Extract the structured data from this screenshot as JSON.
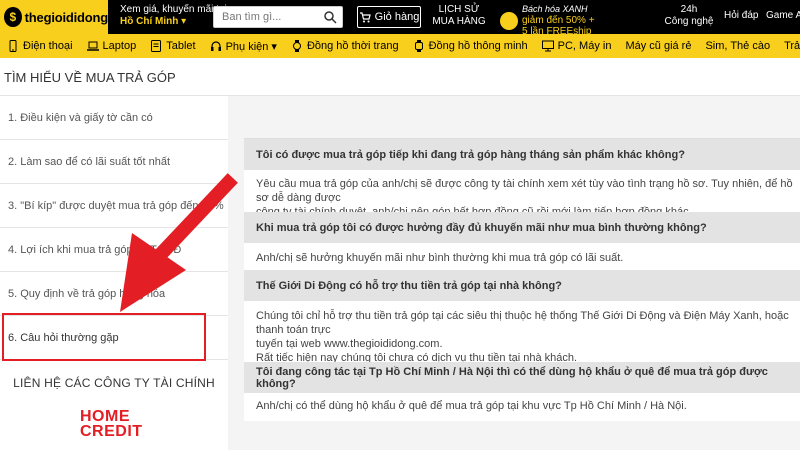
{
  "header": {
    "logo_text": "thegioididong",
    "logo_mark": "$",
    "promo_text": "Xem giá, khuyến mãi tại",
    "location": "Hồ Chí Minh ▾",
    "search_placeholder": "Ban tìm gì...",
    "cart_label": "Giỏ hàng",
    "history_line1": "LỊCH SỬ",
    "history_line2": "MUA HÀNG",
    "bhx_name": "Bách hóa XANH",
    "bhx_offer1": "giảm đến 50% +",
    "bhx_offer2": "5 lần FREEship",
    "tech_line1": "24h",
    "tech_line2": "Công nghệ",
    "hoidap": "Hỏi đáp",
    "gameapp": "Game App"
  },
  "nav": {
    "items": [
      {
        "label": "Điện thoại",
        "icon": "phone-icon"
      },
      {
        "label": "Laptop",
        "icon": "laptop-icon"
      },
      {
        "label": "Tablet",
        "icon": "tablet-icon"
      },
      {
        "label": "Phụ kiện ▾",
        "icon": "headphone-icon"
      },
      {
        "label": "Đồng hồ thời trang",
        "icon": "watch-icon"
      },
      {
        "label": "Đồng hồ thông minh",
        "icon": "smartwatch-icon"
      },
      {
        "label": "PC, Máy in",
        "icon": "pc-icon"
      },
      {
        "label": "Máy cũ giá rẻ",
        "icon": ""
      },
      {
        "label": "Sim, Thẻ cào",
        "icon": ""
      },
      {
        "label": "Trả góp, điện nư",
        "icon": ""
      }
    ]
  },
  "page": {
    "title": "TÌM HIỂU VỀ MUA TRẢ GÓP"
  },
  "sidebar": {
    "items": [
      {
        "label": "1. Điều kiện và giấy tờ cần có"
      },
      {
        "label": "2. Làm sao để có lãi suất tốt nhất"
      },
      {
        "label": "3. \"Bí kíp\" được duyệt mua trả góp đến 90%"
      },
      {
        "label": "4. Lợi ích khi mua trả góp tại TGDĐ"
      },
      {
        "label": "5. Quy định về trả góp hàng hóa"
      },
      {
        "label": "6. Câu hỏi thường gặp"
      }
    ],
    "contact_title": "LIÊN HỆ CÁC CÔNG TY TÀI CHÍNH",
    "hc_line1": "HOME",
    "hc_line2": "CREDIT"
  },
  "faq": [
    {
      "q": "Tôi có được mua trả góp tiếp khi đang trả góp hàng tháng sản phẩm khác không?",
      "a": [
        "Yêu cầu mua trả góp của anh/chị sẽ được công ty tài chính xem xét tùy vào tình trạng hồ sơ. Tuy nhiên, để hồ sơ dễ dàng được",
        "công ty tài chính duyệt, anh/chị nên góp hết hợp đồng cũ rồi mới làm tiếp hợp đồng khác."
      ]
    },
    {
      "q": "Khi mua trả góp tôi có được hưởng đầy đủ khuyến mãi như mua bình thường không?",
      "a": [
        "Anh/chị sẽ hưởng khuyến mãi như bình thường khi mua trả góp có lãi suất."
      ]
    },
    {
      "q": "Thế Giới Di Động có hỗ trợ thu tiền trả góp tại nhà không?",
      "a": [
        "Chúng tôi chỉ hỗ trợ thu tiền trả góp tại các siêu thị thuộc hệ thống Thế Giới Di Động và Điện Máy Xanh, hoặc thanh toán trực",
        "tuyến tại web www.thegioididong.com.",
        "Rất tiếc hiện nay chúng tôi chưa có dịch vụ thu tiền tại nhà khách."
      ]
    },
    {
      "q": "Tôi đang công tác tại Tp Hồ Chí Minh / Hà Nội thì có thể dùng hộ khẩu ở quê để mua trả góp được không?",
      "a": [
        "Anh/chị có thể dùng hộ khẩu ở quê để mua trả góp tại khu vực Tp Hồ Chí Minh / Hà Nội."
      ]
    }
  ],
  "colors": {
    "brand_yellow": "#f8cf1c",
    "header_black": "#000000",
    "highlight_red": "#e31e24",
    "question_bg": "#e3e3e3"
  }
}
